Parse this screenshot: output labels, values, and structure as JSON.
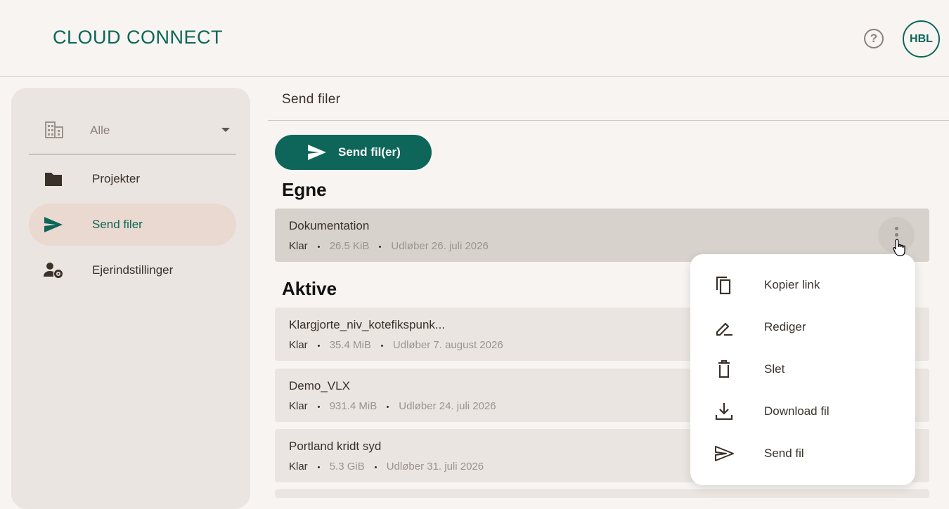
{
  "app": {
    "logo": "CLOUD CONNECT",
    "help_icon": "help-circle-icon",
    "help_glyph": "?",
    "avatar_initials": "HBL",
    "brand_color": "#0d6659"
  },
  "sidebar": {
    "org_select": {
      "value": "Alle",
      "icon": "building-icon"
    },
    "items": [
      {
        "label": "Projekter",
        "icon": "folder-icon",
        "active": false
      },
      {
        "label": "Send filer",
        "icon": "send-icon",
        "active": true
      },
      {
        "label": "Ejerindstillinger",
        "icon": "user-settings-icon",
        "active": false
      }
    ]
  },
  "main": {
    "title": "Send filer",
    "send_button_label": "Send fil(er)",
    "own_section_title": "Egne",
    "active_section_title": "Aktive",
    "own_files": [
      {
        "name": "Dokumentation",
        "status": "Klar",
        "size": "26.5 KiB",
        "expires": "Udløber 26. juli 2026"
      }
    ],
    "active_files": [
      {
        "name": "Klargjorte_niv_kotefikspunk...",
        "status": "Klar",
        "size": "35.4 MiB",
        "expires": "Udløber 7. august 2026"
      },
      {
        "name": "Demo_VLX",
        "status": "Klar",
        "size": "931.4 MiB",
        "expires": "Udløber 24. juli 2026"
      },
      {
        "name": "Portland kridt syd",
        "status": "Klar",
        "size": "5.3 GiB",
        "expires": "Udløber 31. juli 2026"
      }
    ]
  },
  "context_menu": {
    "items": [
      {
        "label": "Kopier link",
        "icon": "copy-icon"
      },
      {
        "label": "Rediger",
        "icon": "edit-icon"
      },
      {
        "label": "Slet",
        "icon": "trash-icon"
      },
      {
        "label": "Download fil",
        "icon": "download-icon"
      },
      {
        "label": "Send fil",
        "icon": "send-outline-icon"
      }
    ]
  }
}
